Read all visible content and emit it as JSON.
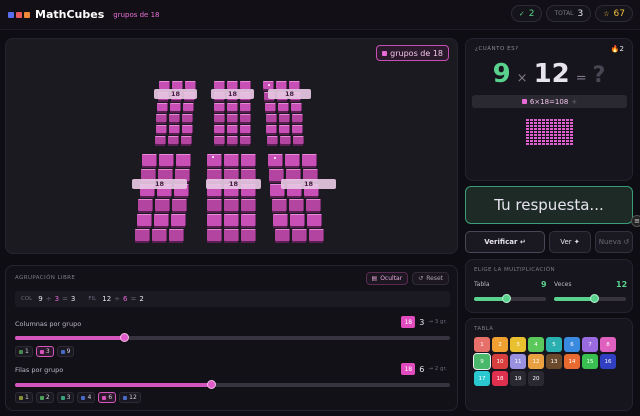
{
  "app": {
    "title": "MathCubes",
    "subtitle": "grupos de 18",
    "logo_colors": [
      "#5a6cf0",
      "#e85a5a",
      "#f0883a"
    ]
  },
  "stats": {
    "correct": {
      "icon": "✓",
      "value": "2",
      "color": "#59d28d"
    },
    "total": {
      "label": "TOTAL",
      "value": "3"
    },
    "score": {
      "icon": "☆",
      "value": "67",
      "color": "#f0c040"
    }
  },
  "scene": {
    "badge": "grupos de 18",
    "group_label": "18",
    "groups": 6
  },
  "question": {
    "label": "¿CUÁNTO ES?",
    "streak": "🔥2",
    "a": "9",
    "times": "×",
    "b": "12",
    "equals": "=",
    "unknown": "?",
    "product_text": "6×18=108",
    "product_tail": "+",
    "stack_columns": 12,
    "stack_rows": 9
  },
  "answer": {
    "placeholder": "Tu respuesta...",
    "keyboard_icon": "≡"
  },
  "buttons": {
    "verify": "Verificar ↵",
    "show": "Ver ✦",
    "next": "Nueva ↺"
  },
  "grouping": {
    "title": "AGRUPACIÓN LIBRE",
    "hide_label": "Ocultar",
    "hide_icon": "▤",
    "reset_label": "Reset",
    "reset_icon": "↺",
    "summary": {
      "col_key": "COL",
      "col_a": "9",
      "col_sep": "÷",
      "col_b": "3",
      "col_eq": "=",
      "col_r": "3",
      "fil_key": "FIL",
      "fil_a": "12",
      "fil_sep": "÷",
      "fil_b": "6",
      "fil_eq": "=",
      "fil_r": "2"
    },
    "columns": {
      "label": "Columnas por grupo",
      "badge": "18",
      "value": "3",
      "unit": "→ 3 gr.",
      "fraction": 0.25,
      "options": [
        {
          "label": "1",
          "color": "#4c8a52"
        },
        {
          "label": "3",
          "color": "#d456bc",
          "selected": true
        },
        {
          "label": "9",
          "color": "#4a6bc4"
        }
      ]
    },
    "rows": {
      "label": "Filas por grupo",
      "badge": "18",
      "value": "6",
      "unit": "→ 2 gr.",
      "fraction": 0.45,
      "options": [
        {
          "label": "1",
          "color": "#8a8f3a"
        },
        {
          "label": "2",
          "color": "#4ca05a"
        },
        {
          "label": "3",
          "color": "#3aa07a"
        },
        {
          "label": "4",
          "color": "#4a6bc4"
        },
        {
          "label": "6",
          "color": "#d456bc",
          "selected": true
        },
        {
          "label": "12",
          "color": "#4a6bc4"
        }
      ]
    }
  },
  "multiplication": {
    "title": "ELIGE LA MULTIPLICACIÓN",
    "tabla_label": "Tabla",
    "tabla_value": "9",
    "tabla_fraction": 0.45,
    "veces_label": "Veces",
    "veces_value": "12",
    "veces_fraction": 0.55,
    "color": "#59d28d"
  },
  "tabla": {
    "title": "TABLA",
    "cells": [
      {
        "n": "1",
        "c": "#e8706a"
      },
      {
        "n": "2",
        "c": "#f0a030"
      },
      {
        "n": "3",
        "c": "#e8c030"
      },
      {
        "n": "4",
        "c": "#5ac85a"
      },
      {
        "n": "5",
        "c": "#2ab0b0"
      },
      {
        "n": "6",
        "c": "#3a8ae0"
      },
      {
        "n": "7",
        "c": "#9a6ae0"
      },
      {
        "n": "8",
        "c": "#e060c0"
      },
      {
        "n": "9",
        "c": "#4ab86a",
        "sel": true
      },
      {
        "n": "10",
        "c": "#d84040"
      },
      {
        "n": "11",
        "c": "#9a90e0"
      },
      {
        "n": "12",
        "c": "#e8a040"
      },
      {
        "n": "13",
        "c": "#6a4a2a"
      },
      {
        "n": "14",
        "c": "#e86a30"
      },
      {
        "n": "15",
        "c": "#3ac050"
      },
      {
        "n": "16",
        "c": "#3040c0"
      },
      {
        "n": "17",
        "c": "#2ac8d0"
      },
      {
        "n": "18",
        "c": "#e03050"
      },
      {
        "n": "19",
        "c": "#2a2830"
      },
      {
        "n": "20",
        "c": "#2a2830"
      }
    ]
  }
}
